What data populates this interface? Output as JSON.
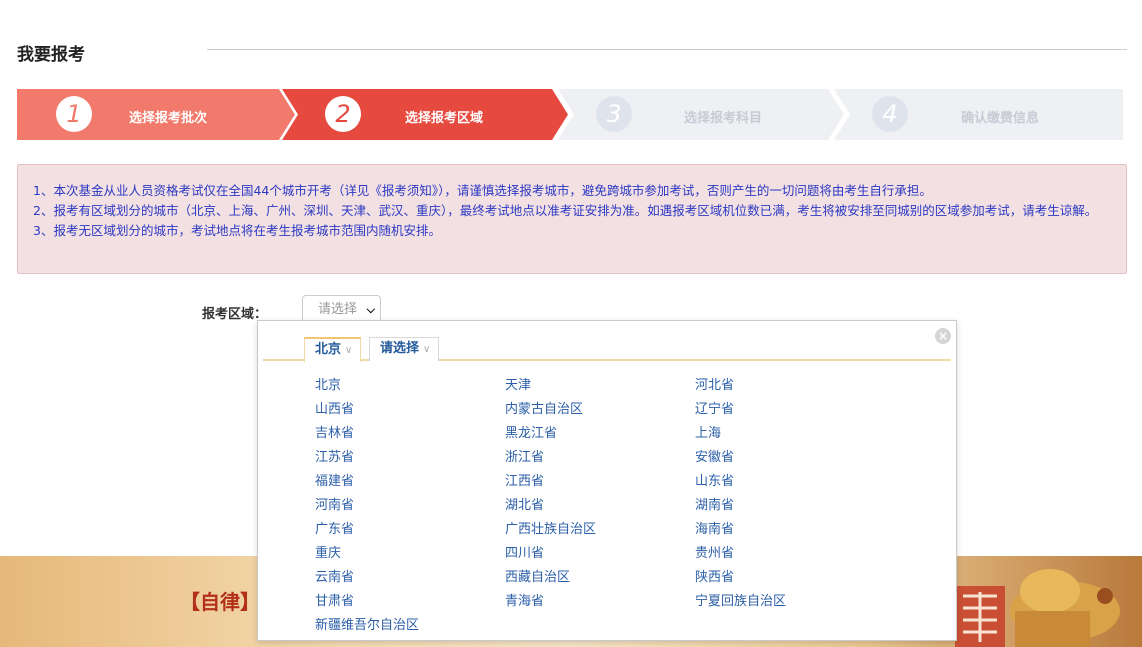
{
  "page": {
    "title": "我要报考"
  },
  "steps": [
    {
      "num": "1",
      "label": "选择报考批次",
      "state": "done"
    },
    {
      "num": "2",
      "label": "选择报考区域",
      "state": "current"
    },
    {
      "num": "3",
      "label": "选择报考科目",
      "state": "todo"
    },
    {
      "num": "4",
      "label": "确认缴费信息",
      "state": "todo"
    }
  ],
  "colors": {
    "done": "#f27a6c",
    "current": "#e64a3f",
    "todo": "#eef0f4",
    "notice_bg": "#f3e0e2",
    "notice_text": "#2c39c4",
    "link": "#2c5fa8"
  },
  "notice": {
    "line1": "1、本次基金从业人员资格考试仅在全国44个城市开考（详见《报考须知》），请谨慎选择报考城市，避免跨城市参加考试，否则产生的一切问题将由考生自行承担。",
    "line2": "2、报考有区域划分的城市（北京、上海、广州、深圳、天津、武汉、重庆），最终考试地点以准考证安排为准。如遇报考区域机位数已满，考生将被安排至同城别的区域参加考试，请考生谅解。",
    "line3": "3、报考无区域划分的城市，考试地点将在考生报考城市范围内随机安排。"
  },
  "region": {
    "label": "报考区域：",
    "select_value": "请选择"
  },
  "popup": {
    "tabs": [
      {
        "label": "北京",
        "active": true
      },
      {
        "label": "请选择",
        "active": false
      }
    ],
    "close_icon": "close-icon",
    "provinces": [
      "北京",
      "天津",
      "河北省",
      "山西省",
      "内蒙古自治区",
      "辽宁省",
      "吉林省",
      "黑龙江省",
      "上海",
      "江苏省",
      "浙江省",
      "安徽省",
      "福建省",
      "江西省",
      "山东省",
      "河南省",
      "湖北省",
      "湖南省",
      "广东省",
      "广西壮族自治区",
      "海南省",
      "重庆",
      "四川省",
      "贵州省",
      "云南省",
      "西藏自治区",
      "陕西省",
      "甘肃省",
      "青海省",
      "宁夏回族自治区",
      "新疆维吾尔自治区"
    ]
  },
  "banner": {
    "text": "【自律】"
  }
}
